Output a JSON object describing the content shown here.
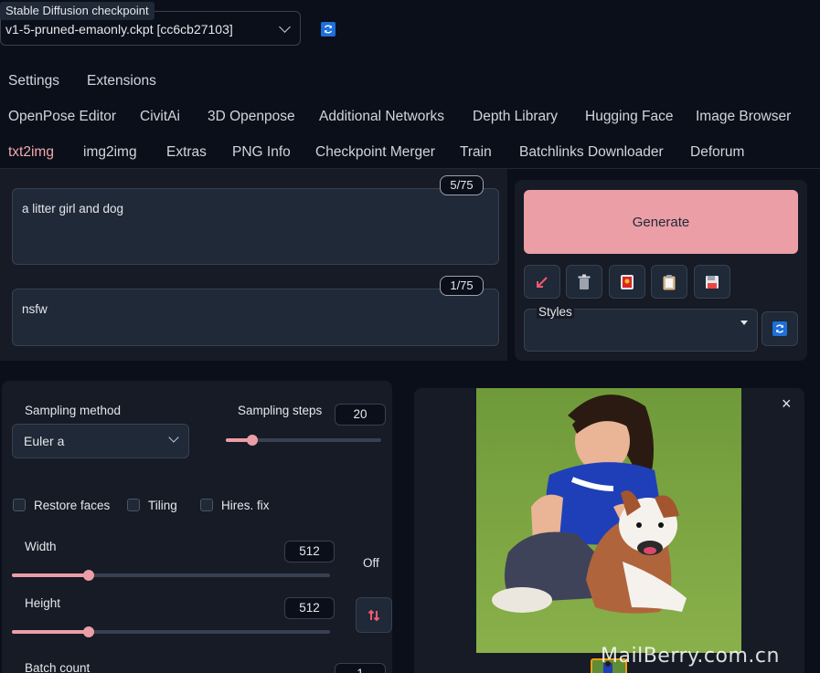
{
  "checkpoint": {
    "label": "Stable Diffusion checkpoint",
    "value": "v1-5-pruned-emaonly.ckpt [cc6cb27103]"
  },
  "tabs_row1": [
    "Settings",
    "Extensions"
  ],
  "tabs_row2": [
    "OpenPose Editor",
    "CivitAi",
    "3D Openpose",
    "Additional Networks",
    "Depth Library",
    "Hugging Face",
    "Image Browser"
  ],
  "tabs_row3": [
    "txt2img",
    "img2img",
    "Extras",
    "PNG Info",
    "Checkpoint Merger",
    "Train",
    "Batchlinks Downloader",
    "Deforum"
  ],
  "active_tab": "txt2img",
  "prompt": {
    "value": "a litter girl and dog",
    "counter": "5/75"
  },
  "negative_prompt": {
    "value": "nsfw",
    "counter": "1/75"
  },
  "generate_label": "Generate",
  "tool_icons": [
    "arrow-icon",
    "trash-icon",
    "red-card-icon",
    "clipboard-icon",
    "save-icon"
  ],
  "styles": {
    "label": "Styles",
    "value": ""
  },
  "sampling": {
    "method_label": "Sampling method",
    "method_value": "Euler a",
    "steps_label": "Sampling steps",
    "steps_value": "20",
    "steps_fraction": 0.17
  },
  "options": {
    "restore_faces": "Restore faces",
    "tiling": "Tiling",
    "hires_fix": "Hires. fix"
  },
  "width": {
    "label": "Width",
    "value": "512",
    "fraction": 0.24
  },
  "height": {
    "label": "Height",
    "value": "512",
    "fraction": 0.24
  },
  "off_label": "Off",
  "batch_count": {
    "label": "Batch count",
    "value": "1"
  },
  "output_close": "×",
  "watermark": "MailBerry.com.cn",
  "colors": {
    "accent": "#eb9ea6",
    "background": "#0b0f19",
    "panel": "#1f2937"
  }
}
